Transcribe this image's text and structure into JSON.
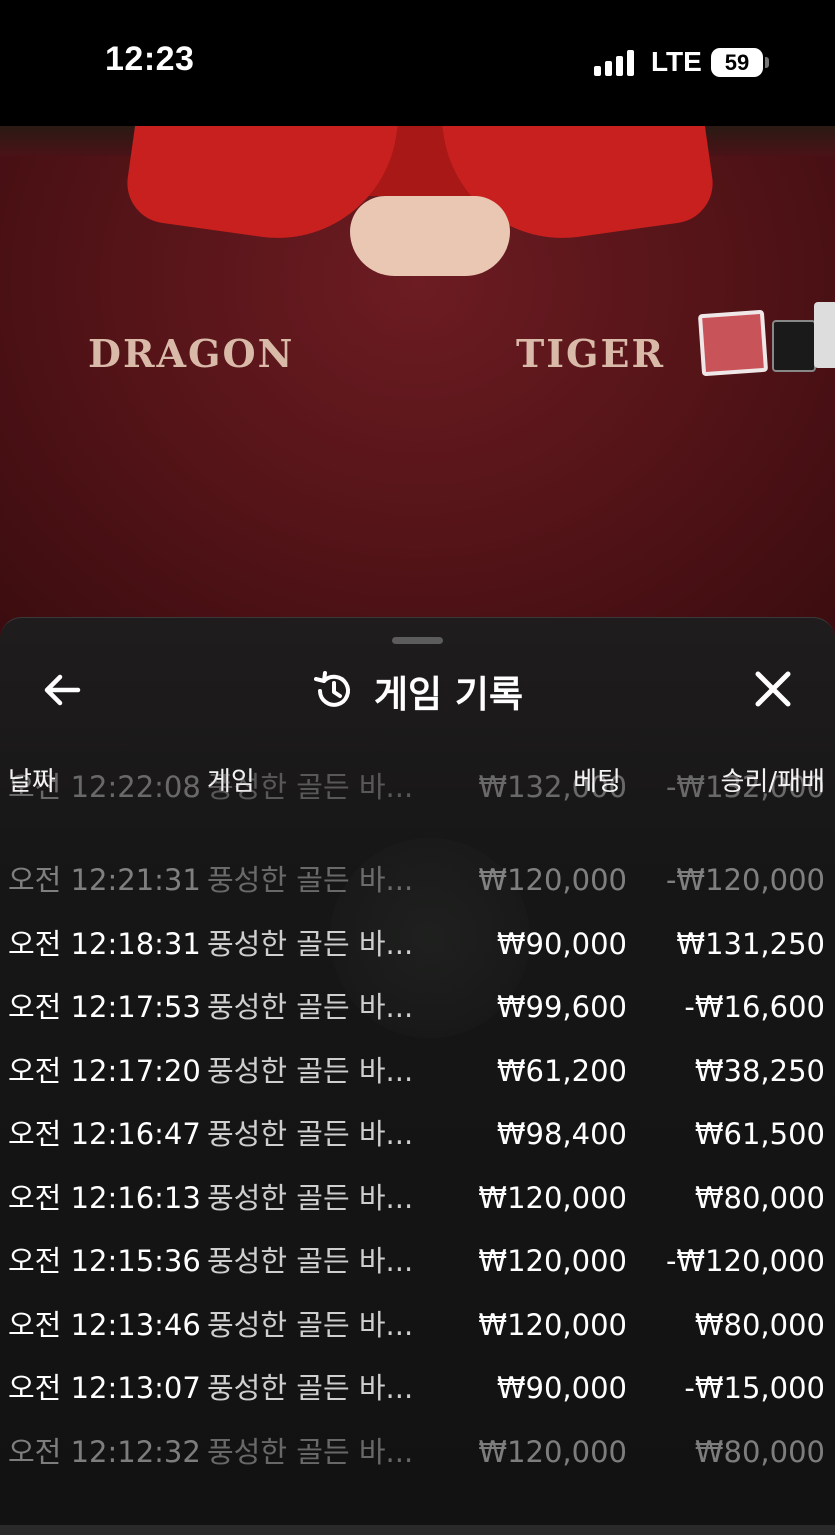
{
  "status_bar": {
    "time": "12:23",
    "network": "LTE",
    "battery": "59"
  },
  "video": {
    "left_label": "DRAGON",
    "right_label": "TIGER"
  },
  "sheet": {
    "title": "게임 기록",
    "columns": {
      "date": "날짜",
      "game": "게임",
      "bet": "베팅",
      "win_loss": "승리/패배"
    },
    "rows": [
      {
        "date": "오전 12:22:08",
        "game": "풍성한 골든 바...",
        "bet": "₩132,000",
        "result": "-₩132,000"
      },
      {
        "date": "오전 12:21:31",
        "game": "풍성한 골든 바...",
        "bet": "₩120,000",
        "result": "-₩120,000"
      },
      {
        "date": "오전 12:18:31",
        "game": "풍성한 골든 바...",
        "bet": "₩90,000",
        "result": "₩131,250"
      },
      {
        "date": "오전 12:17:53",
        "game": "풍성한 골든 바...",
        "bet": "₩99,600",
        "result": "-₩16,600"
      },
      {
        "date": "오전 12:17:20",
        "game": "풍성한 골든 바...",
        "bet": "₩61,200",
        "result": "₩38,250"
      },
      {
        "date": "오전 12:16:47",
        "game": "풍성한 골든 바...",
        "bet": "₩98,400",
        "result": "₩61,500"
      },
      {
        "date": "오전 12:16:13",
        "game": "풍성한 골든 바...",
        "bet": "₩120,000",
        "result": "₩80,000"
      },
      {
        "date": "오전 12:15:36",
        "game": "풍성한 골든 바...",
        "bet": "₩120,000",
        "result": "-₩120,000"
      },
      {
        "date": "오전 12:13:46",
        "game": "풍성한 골든 바...",
        "bet": "₩120,000",
        "result": "₩80,000"
      },
      {
        "date": "오전 12:13:07",
        "game": "풍성한 골든 바...",
        "bet": "₩90,000",
        "result": "-₩15,000"
      },
      {
        "date": "오전 12:12:32",
        "game": "풍성한 골든 바...",
        "bet": "₩120,000",
        "result": "₩80,000"
      }
    ]
  },
  "icons": {
    "back": "arrow-left-icon",
    "history": "history-icon",
    "close": "close-icon"
  }
}
